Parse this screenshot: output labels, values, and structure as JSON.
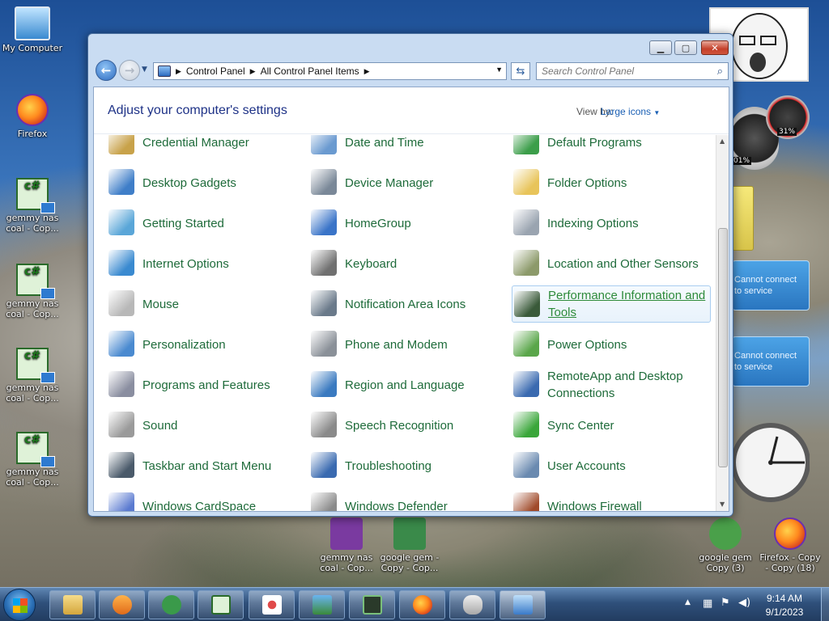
{
  "desktop": {
    "icons": [
      {
        "label": "My Computer"
      },
      {
        "label": "Firefox"
      },
      {
        "label": "gemmy nas coal - Cop..."
      },
      {
        "label": "gemmy nas coal - Cop..."
      },
      {
        "label": "gemmy nas coal - Cop..."
      },
      {
        "label": "gemmy nas coal - Cop..."
      },
      {
        "label": "gemmy nas coal - Cop..."
      },
      {
        "label": "google gem - Copy - Cop..."
      },
      {
        "label": "google gem Copy (3)"
      },
      {
        "label": "Firefox - Copy - Copy (18)"
      }
    ],
    "gadgets": {
      "meter_percent": "31%",
      "meter2_percent": "01%",
      "weather_1": "Cannot connect to service",
      "weather_2": "Cannot connect to service"
    }
  },
  "window": {
    "breadcrumb": [
      "Control Panel",
      "All Control Panel Items"
    ],
    "search_placeholder": "Search Control Panel",
    "page_title": "Adjust your computer's settings",
    "view_by_label": "View by:",
    "view_by_value": "Large icons",
    "items": [
      {
        "label": "Credential Manager",
        "icon": "credential-manager-icon",
        "color": "#c8a24a"
      },
      {
        "label": "Date and Time",
        "icon": "date-time-icon",
        "color": "#6a9ad0"
      },
      {
        "label": "Default Programs",
        "icon": "default-programs-icon",
        "color": "#3c9e4a"
      },
      {
        "label": "Desktop Gadgets",
        "icon": "desktop-gadgets-icon",
        "color": "#3f7ec8"
      },
      {
        "label": "Device Manager",
        "icon": "device-manager-icon",
        "color": "#7a8898"
      },
      {
        "label": "Folder Options",
        "icon": "folder-options-icon",
        "color": "#e8c45a"
      },
      {
        "label": "Getting Started",
        "icon": "getting-started-icon",
        "color": "#5aa6d8"
      },
      {
        "label": "HomeGroup",
        "icon": "homegroup-icon",
        "color": "#3a74c8"
      },
      {
        "label": "Indexing Options",
        "icon": "indexing-options-icon",
        "color": "#9aa4b0"
      },
      {
        "label": "Internet Options",
        "icon": "internet-options-icon",
        "color": "#3a8ad0"
      },
      {
        "label": "Keyboard",
        "icon": "keyboard-icon",
        "color": "#707070"
      },
      {
        "label": "Location and Other Sensors",
        "icon": "location-sensors-icon",
        "color": "#8c9a6a"
      },
      {
        "label": "Mouse",
        "icon": "mouse-icon",
        "color": "#b8b8b8"
      },
      {
        "label": "Notification Area Icons",
        "icon": "notification-area-icon",
        "color": "#6a7a8a"
      },
      {
        "label": "Performance Information and Tools",
        "icon": "performance-icon",
        "color": "#3a5a3a"
      },
      {
        "label": "Personalization",
        "icon": "personalization-icon",
        "color": "#4a8ad0"
      },
      {
        "label": "Phone and Modem",
        "icon": "phone-modem-icon",
        "color": "#8a9098"
      },
      {
        "label": "Power Options",
        "icon": "power-options-icon",
        "color": "#5aa64a"
      },
      {
        "label": "Programs and Features",
        "icon": "programs-features-icon",
        "color": "#8a8ea0"
      },
      {
        "label": "Region and Language",
        "icon": "region-language-icon",
        "color": "#3a7ac0"
      },
      {
        "label": "RemoteApp and Desktop Connections",
        "icon": "remoteapp-icon",
        "color": "#3a6ab0"
      },
      {
        "label": "Sound",
        "icon": "sound-icon",
        "color": "#9a9a9a"
      },
      {
        "label": "Speech Recognition",
        "icon": "speech-recognition-icon",
        "color": "#8a8a8a"
      },
      {
        "label": "Sync Center",
        "icon": "sync-center-icon",
        "color": "#3aa63a"
      },
      {
        "label": "Taskbar and Start Menu",
        "icon": "taskbar-start-icon",
        "color": "#4a5a6a"
      },
      {
        "label": "Troubleshooting",
        "icon": "troubleshooting-icon",
        "color": "#3a6ab0"
      },
      {
        "label": "User Accounts",
        "icon": "user-accounts-icon",
        "color": "#6a8ab0"
      },
      {
        "label": "Windows CardSpace",
        "icon": "cardspace-icon",
        "color": "#5a7ad0"
      },
      {
        "label": "Windows Defender",
        "icon": "defender-icon",
        "color": "#8a8a8a"
      },
      {
        "label": "Windows Firewall",
        "icon": "firewall-icon",
        "color": "#a04a2a"
      }
    ]
  },
  "taskbar": {
    "clock_time": "9:14 AM",
    "clock_date": "9/1/2023"
  }
}
